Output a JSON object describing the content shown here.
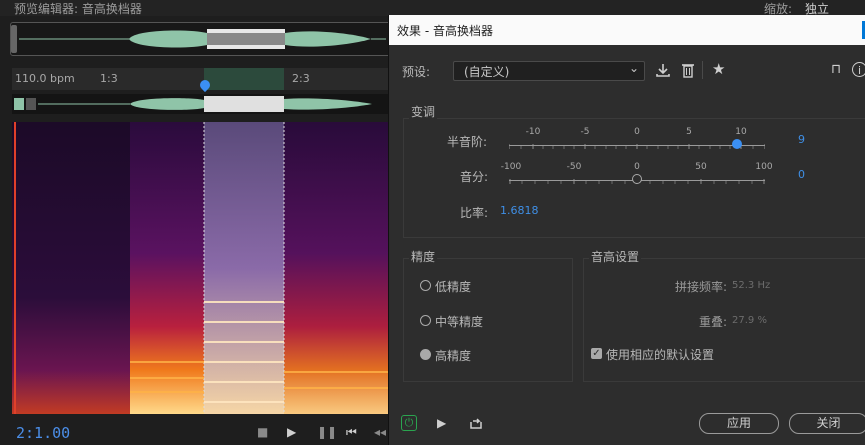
{
  "editor": {
    "title": "预览编辑器: 音高换档器",
    "zoom_label": "缩放:",
    "zoom_value": "独立",
    "ruler": {
      "bpm": "110.0 bpm",
      "marks": [
        "1:3",
        "2:3"
      ]
    },
    "time_display": "2:1.00"
  },
  "dialog": {
    "title": "效果 - 音高换档器",
    "preset_label": "预设:",
    "preset_value": "(自定义)",
    "icons": [
      "save-preset-icon",
      "delete-preset-icon",
      "favorite-star-icon",
      "routing-icon",
      "info-icon"
    ],
    "pitch": {
      "section_title": "变调",
      "semitones_label": "半音阶:",
      "semitones_ticks": [
        "-10",
        "-5",
        "0",
        "5",
        "10"
      ],
      "semitones_value": "9",
      "cents_label": "音分:",
      "cents_ticks": [
        "-100",
        "-50",
        "0",
        "50",
        "100"
      ],
      "cents_value": "0",
      "ratio_label": "比率:",
      "ratio_value": "1.6818"
    },
    "precision": {
      "section_title": "精度",
      "options": [
        "低精度",
        "中等精度",
        "高精度"
      ],
      "selected": "高精度"
    },
    "pitch_settings": {
      "section_title": "音高设置",
      "splice_label": "拼接频率:",
      "splice_value": "52.3 Hz",
      "overlap_label": "重叠:",
      "overlap_value": "27.9 %",
      "default_checkbox_label": "使用相应的默认设置",
      "default_checked": true
    },
    "footer": {
      "apply_label": "应用",
      "close_label": "关闭"
    }
  },
  "colors": {
    "accent": "#3b8ff2",
    "power_green": "#2aa44f",
    "waveform": "#8fc4a8"
  }
}
